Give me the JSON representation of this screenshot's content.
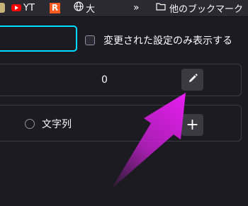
{
  "bookmarks_bar": {
    "items": [
      {
        "label": "YT",
        "icon": "youtube-icon"
      },
      {
        "label": "",
        "icon": "r-logo-icon"
      },
      {
        "label": "大",
        "icon": "globe-icon"
      },
      {
        "label": "他のブックマーク",
        "icon": "folder-icon"
      }
    ],
    "overflow_label": "»",
    "r_logo_letter": "R"
  },
  "filter": {
    "search_value": "",
    "modified_only_label": "変更された設定のみ表示する",
    "modified_only_checked": false
  },
  "pref_row": {
    "value": "0",
    "edit_icon": "pencil-icon"
  },
  "new_pref_row": {
    "type_string_label": "文字列",
    "add_label": "+"
  },
  "annotation": {
    "arrow_color": "#e020e8"
  },
  "colors": {
    "background": "#1c1b22",
    "focus_ring": "#00ddff",
    "button": "#3b3a43"
  }
}
